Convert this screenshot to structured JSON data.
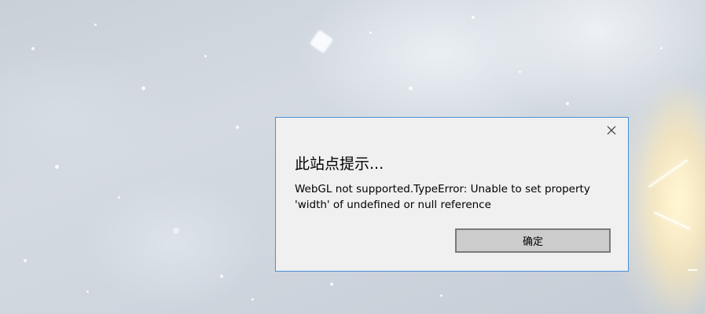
{
  "dialog": {
    "title": "此站点提示...",
    "message": "WebGL not supported.TypeError: Unable to set property 'width' of undefined or null reference",
    "ok_label": "确定",
    "close_icon": "close-icon"
  },
  "colors": {
    "dialog_border": "#4a90d9",
    "dialog_background": "#f0f0f0",
    "button_background": "#cccccc",
    "button_border": "#7a7a7a"
  }
}
